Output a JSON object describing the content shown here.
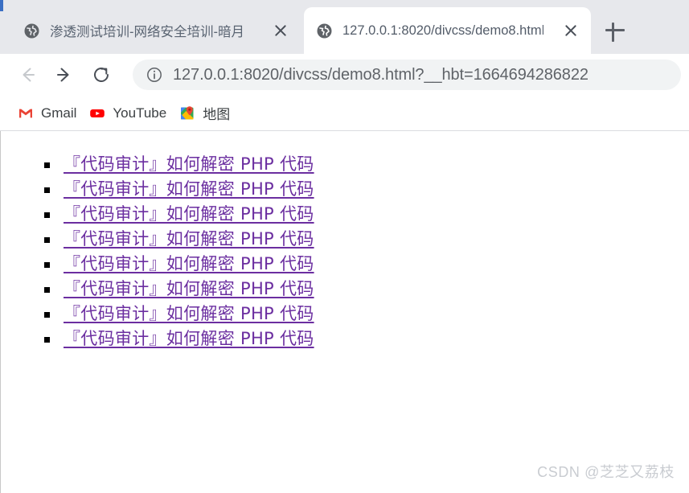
{
  "browser": {
    "tabs": [
      {
        "title": "渗透测试培训-网络安全培训-暗月",
        "favicon": "globe-icon",
        "active": false,
        "close_label": "×"
      },
      {
        "title": "127.0.0.1:8020/divcss/demo8.html",
        "favicon": "globe-icon",
        "active": true,
        "close_label": "×"
      }
    ],
    "new_tab_label": "+",
    "toolbar": {
      "back_label": "←",
      "forward_label": "→",
      "reload_label": "⟳",
      "site_info_label": "ⓘ",
      "url": "127.0.0.1:8020/divcss/demo8.html?__hbt=1664694286822"
    },
    "bookmarks": [
      {
        "label": "Gmail",
        "icon": "gmail-icon"
      },
      {
        "label": "YouTube",
        "icon": "youtube-icon"
      },
      {
        "label": "地图",
        "icon": "google-maps-icon"
      }
    ]
  },
  "page": {
    "links": [
      {
        "text": "『代码审计』如何解密 PHP 代码"
      },
      {
        "text": "『代码审计』如何解密 PHP 代码"
      },
      {
        "text": "『代码审计』如何解密 PHP 代码"
      },
      {
        "text": "『代码审计』如何解密 PHP 代码"
      },
      {
        "text": "『代码审计』如何解密 PHP 代码"
      },
      {
        "text": "『代码审计』如何解密 PHP 代码"
      },
      {
        "text": "『代码审计』如何解密 PHP 代码"
      },
      {
        "text": "『代码审计』如何解密 PHP 代码"
      }
    ],
    "watermark": "CSDN @芝芝又荔枝",
    "link_color": "#6b2ea0",
    "bullet_color": "#000000"
  }
}
